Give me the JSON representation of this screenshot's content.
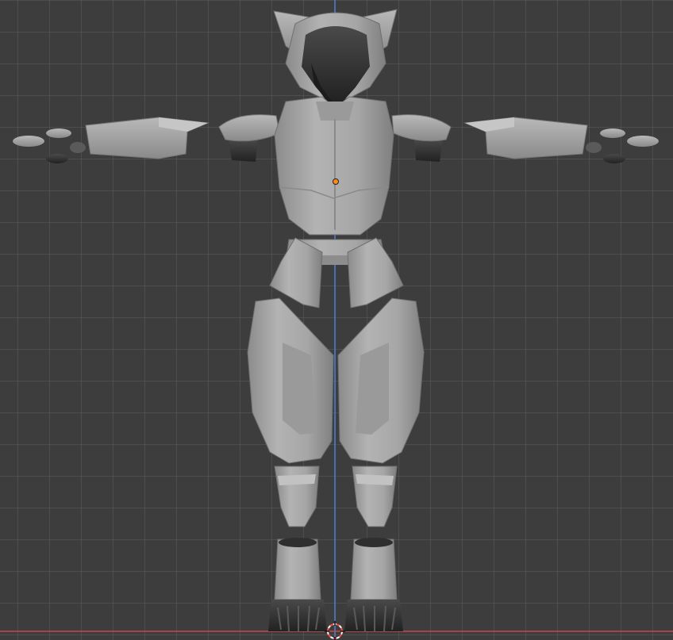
{
  "app": "3D Viewport",
  "viewport": {
    "view": "front-orthographic",
    "grid": true,
    "background_color": "#3d3d3d",
    "grid_color": "#555555",
    "axis_z_color": "#4a7fd4",
    "axis_x_color": "#c84a4a",
    "origin_point_color": "#ff8c1a",
    "cursor_3d_colors": [
      "#ff4a4a",
      "#ffffff"
    ]
  },
  "model": {
    "name": "",
    "parts": [
      "helmet",
      "helmet-ear-left",
      "helmet-ear-right",
      "helmet-visor",
      "chest-plate",
      "shoulder-left",
      "shoulder-right",
      "upper-arm-left",
      "upper-arm-right",
      "hand-left",
      "hand-right",
      "waist-belt",
      "hip-plate-left",
      "hip-plate-right",
      "thigh-left",
      "thigh-right",
      "shin-left",
      "shin-right",
      "boot-left",
      "boot-right",
      "foot-left",
      "foot-right"
    ],
    "material_color": "#a9a9a9",
    "dark_material_color": "#2d2d2d"
  }
}
